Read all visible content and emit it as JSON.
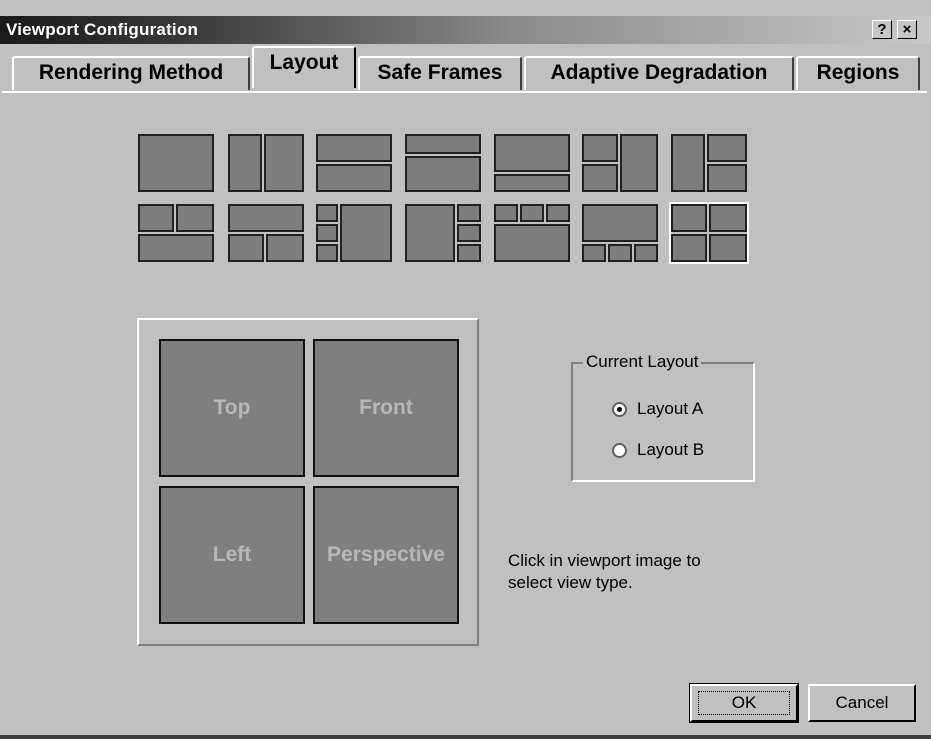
{
  "window": {
    "title": "Viewport Configuration",
    "help_label": "?",
    "close_label": "×"
  },
  "tabs": [
    {
      "label": "Rendering Method",
      "active": false
    },
    {
      "label": "Layout",
      "active": true
    },
    {
      "label": "Safe Frames",
      "active": false
    },
    {
      "label": "Adaptive Degradation",
      "active": false
    },
    {
      "label": "Regions",
      "active": false
    }
  ],
  "layout_presets": {
    "count": 14,
    "selected_index": 13
  },
  "viewports": {
    "top_left": "Top",
    "top_right": "Front",
    "bottom_left": "Left",
    "bottom_right": "Perspective"
  },
  "current_layout": {
    "title": "Current Layout",
    "options": [
      {
        "label": "Layout A",
        "checked": true
      },
      {
        "label": "Layout B",
        "checked": false
      }
    ]
  },
  "hint": "Click in viewport image to select view type.",
  "buttons": {
    "ok": "OK",
    "cancel": "Cancel"
  }
}
